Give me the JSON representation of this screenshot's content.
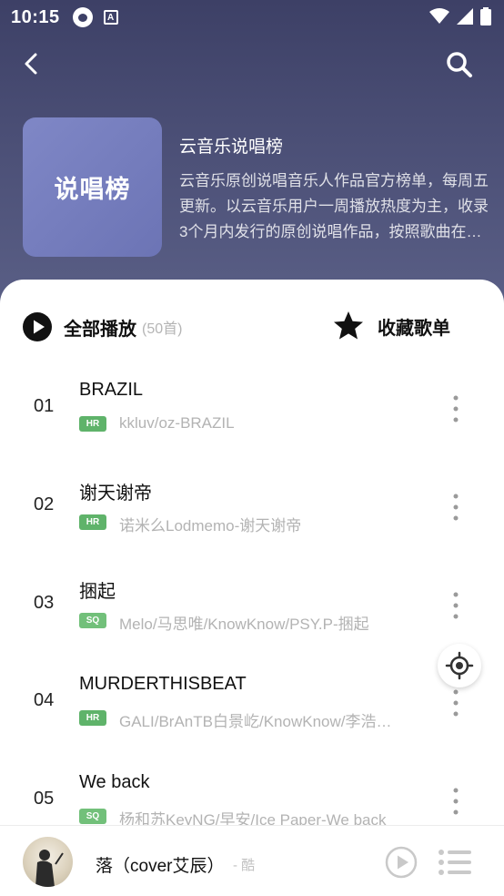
{
  "status_bar": {
    "time": "10:15",
    "icons": [
      "music-app-icon",
      "a-icon",
      "wifi-icon",
      "signal-icon",
      "battery-icon"
    ]
  },
  "nav": {
    "back_icon": "chevron-left-icon",
    "search_icon": "search-icon"
  },
  "playlist": {
    "cover_text": "说唱榜",
    "title": "云音乐说唱榜",
    "description": "云音乐原创说唱音乐人作品官方榜单，每周五更新。以云音乐用户一周播放热度为主，收录3个月内发行的原创说唱作品，按照歌曲在云音乐的热度排行。"
  },
  "actions": {
    "play_all_label": "全部播放",
    "play_all_count": "(50首)",
    "collect_label": "收藏歌单"
  },
  "songs": [
    {
      "num": "01",
      "title": "BRAZIL",
      "badge": "HR",
      "artist": "kkluv/oz-BRAZIL"
    },
    {
      "num": "02",
      "title": "谢天谢帝",
      "badge": "HR",
      "artist": "诺米么Lodmemo-谢天谢帝"
    },
    {
      "num": "03",
      "title": "捆起",
      "badge": "SQ",
      "artist": "Melo/马思唯/KnowKnow/PSY.P-捆起"
    },
    {
      "num": "04",
      "title": "MURDERTHISBEAT",
      "badge": "HR",
      "artist": "GALI/BrAnTB白景屹/KnowKnow/李浩源-MURDERTHISBEAT"
    },
    {
      "num": "05",
      "title": "We back",
      "badge": "SQ",
      "artist": "杨和苏KeyNG/早安/Ice Paper-We back"
    }
  ],
  "player": {
    "title": "落（cover艾辰）",
    "artist": "- 酷",
    "play_icon": "play-circle-icon",
    "list_icon": "playlist-icon"
  },
  "colors": {
    "header_bg": "#45496f",
    "cover_bg": "#7a82c2",
    "hr_badge": "#5fb36a",
    "muted_text": "#b3b3b3"
  }
}
